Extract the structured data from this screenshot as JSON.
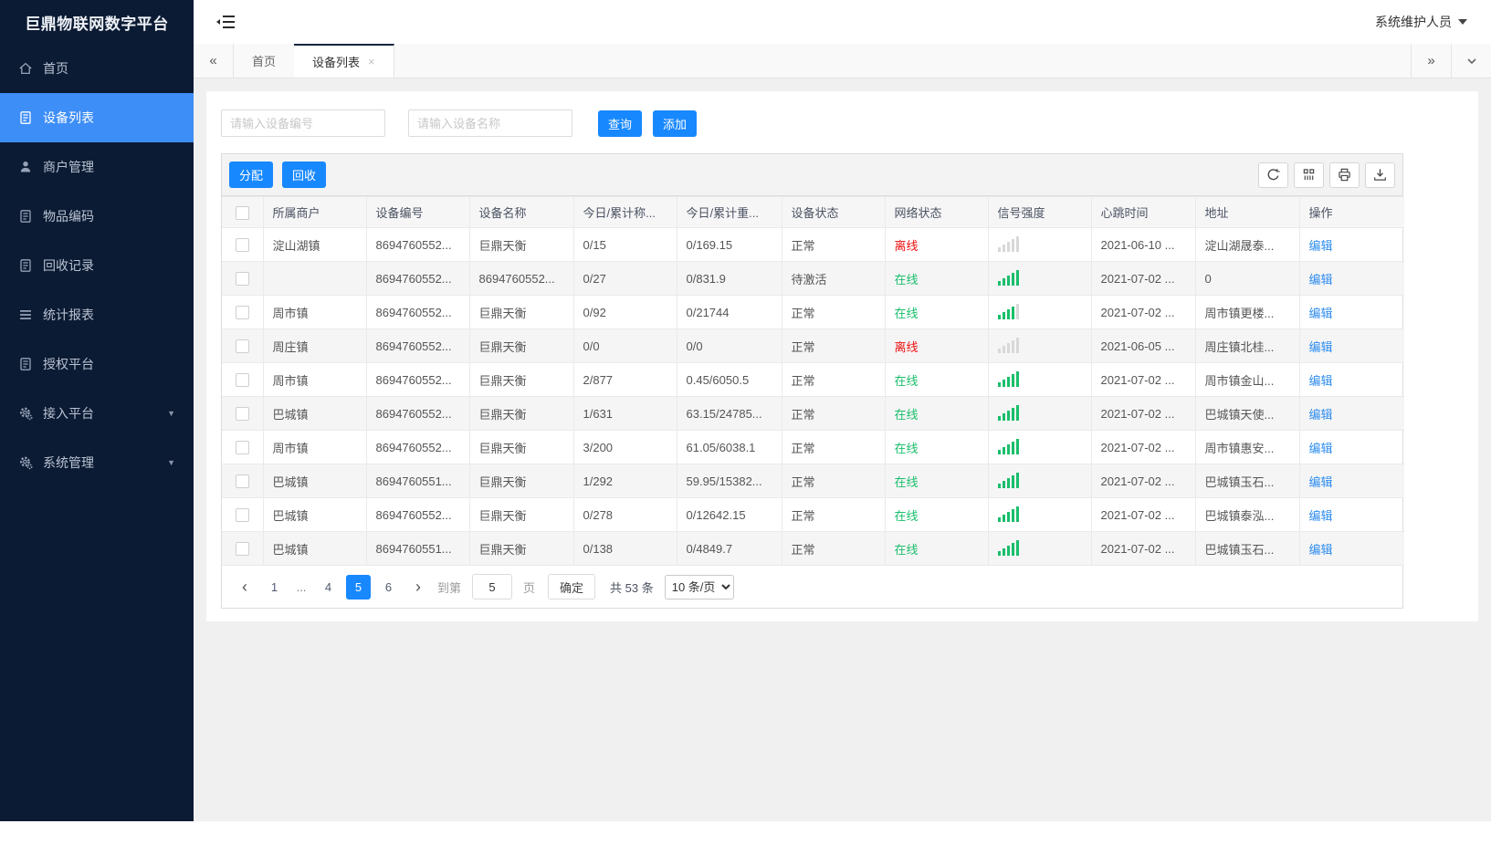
{
  "app": {
    "title": "巨鼎物联网数字平台",
    "user": "系统维护人员"
  },
  "sidebar": {
    "items": [
      {
        "name": "home",
        "label": "首页",
        "icon": "home",
        "active": false,
        "expandable": false
      },
      {
        "name": "device-list",
        "label": "设备列表",
        "icon": "doc",
        "active": true,
        "expandable": false
      },
      {
        "name": "merchant-management",
        "label": "商户管理",
        "icon": "user",
        "active": false,
        "expandable": false
      },
      {
        "name": "item-coding",
        "label": "物品编码",
        "icon": "doc",
        "active": false,
        "expandable": false
      },
      {
        "name": "recycle-records",
        "label": "回收记录",
        "icon": "doc",
        "active": false,
        "expandable": false
      },
      {
        "name": "statistics-report",
        "label": "统计报表",
        "icon": "lines",
        "active": false,
        "expandable": false
      },
      {
        "name": "authorization-platform",
        "label": "授权平台",
        "icon": "doc",
        "active": false,
        "expandable": false
      },
      {
        "name": "access-platform",
        "label": "接入平台",
        "icon": "gear",
        "active": false,
        "expandable": true
      },
      {
        "name": "system-management",
        "label": "系统管理",
        "icon": "gear",
        "active": false,
        "expandable": true
      }
    ]
  },
  "tabs": [
    {
      "name": "home",
      "label": "首页",
      "active": false,
      "closable": false
    },
    {
      "name": "device-list",
      "label": "设备列表",
      "active": true,
      "closable": true
    }
  ],
  "search": {
    "device_no_placeholder": "请输入设备编号",
    "device_name_placeholder": "请输入设备名称",
    "query_label": "查询",
    "add_label": "添加"
  },
  "toolbar": {
    "assign_label": "分配",
    "recycle_label": "回收"
  },
  "table": {
    "columns": [
      "所属商户",
      "设备编号",
      "设备名称",
      "今日/累计称...",
      "今日/累计重...",
      "设备状态",
      "网络状态",
      "信号强度",
      "心跳时间",
      "地址",
      "操作"
    ],
    "rows": [
      {
        "merchant": "淀山湖镇",
        "device_no": "8694760552...",
        "device_name": "巨鼎天衡",
        "today_count": "0/15",
        "today_weight": "0/169.15",
        "status": "正常",
        "network": "离线",
        "online": false,
        "signal": 0,
        "heartbeat": "2021-06-10 ...",
        "address": "淀山湖晟泰...",
        "action": "编辑"
      },
      {
        "merchant": "",
        "device_no": "8694760552...",
        "device_name": "8694760552...",
        "today_count": "0/27",
        "today_weight": "0/831.9",
        "status": "待激活",
        "network": "在线",
        "online": true,
        "signal": 5,
        "heartbeat": "2021-07-02 ...",
        "address": "0",
        "action": "编辑"
      },
      {
        "merchant": "周市镇",
        "device_no": "8694760552...",
        "device_name": "巨鼎天衡",
        "today_count": "0/92",
        "today_weight": "0/21744",
        "status": "正常",
        "network": "在线",
        "online": true,
        "signal": 4,
        "heartbeat": "2021-07-02 ...",
        "address": "周市镇更楼...",
        "action": "编辑"
      },
      {
        "merchant": "周庄镇",
        "device_no": "8694760552...",
        "device_name": "巨鼎天衡",
        "today_count": "0/0",
        "today_weight": "0/0",
        "status": "正常",
        "network": "离线",
        "online": false,
        "signal": 0,
        "heartbeat": "2021-06-05 ...",
        "address": "周庄镇北桂...",
        "action": "编辑"
      },
      {
        "merchant": "周市镇",
        "device_no": "8694760552...",
        "device_name": "巨鼎天衡",
        "today_count": "2/877",
        "today_weight": "0.45/6050.5",
        "status": "正常",
        "network": "在线",
        "online": true,
        "signal": 5,
        "heartbeat": "2021-07-02 ...",
        "address": "周市镇金山...",
        "action": "编辑"
      },
      {
        "merchant": "巴城镇",
        "device_no": "8694760552...",
        "device_name": "巨鼎天衡",
        "today_count": "1/631",
        "today_weight": "63.15/24785...",
        "status": "正常",
        "network": "在线",
        "online": true,
        "signal": 5,
        "heartbeat": "2021-07-02 ...",
        "address": "巴城镇天使...",
        "action": "编辑"
      },
      {
        "merchant": "周市镇",
        "device_no": "8694760552...",
        "device_name": "巨鼎天衡",
        "today_count": "3/200",
        "today_weight": "61.05/6038.1",
        "status": "正常",
        "network": "在线",
        "online": true,
        "signal": 5,
        "heartbeat": "2021-07-02 ...",
        "address": "周市镇惠安...",
        "action": "编辑"
      },
      {
        "merchant": "巴城镇",
        "device_no": "8694760551...",
        "device_name": "巨鼎天衡",
        "today_count": "1/292",
        "today_weight": "59.95/15382...",
        "status": "正常",
        "network": "在线",
        "online": true,
        "signal": 5,
        "heartbeat": "2021-07-02 ...",
        "address": "巴城镇玉石...",
        "action": "编辑"
      },
      {
        "merchant": "巴城镇",
        "device_no": "8694760552...",
        "device_name": "巨鼎天衡",
        "today_count": "0/278",
        "today_weight": "0/12642.15",
        "status": "正常",
        "network": "在线",
        "online": true,
        "signal": 5,
        "heartbeat": "2021-07-02 ...",
        "address": "巴城镇泰泓...",
        "action": "编辑"
      },
      {
        "merchant": "巴城镇",
        "device_no": "8694760551...",
        "device_name": "巨鼎天衡",
        "today_count": "0/138",
        "today_weight": "0/4849.7",
        "status": "正常",
        "network": "在线",
        "online": true,
        "signal": 5,
        "heartbeat": "2021-07-02 ...",
        "address": "巴城镇玉石...",
        "action": "编辑"
      }
    ]
  },
  "pagination": {
    "pages": [
      "1",
      "...",
      "4",
      "5",
      "6"
    ],
    "active_page": "5",
    "goto_label": "到第",
    "goto_value": "5",
    "page_unit": "页",
    "confirm_label": "确定",
    "total_text": "共 53 条",
    "page_size": "10 条/页"
  },
  "icons": {
    "collapse-menu-icon": "menu-fold lines",
    "caret-down-icon": "▼",
    "chevrons-left-icon": "«",
    "chevrons-right-icon": "»",
    "chevron-down-icon": "⌄",
    "chevron-left-icon": "‹",
    "chevron-right-icon": "›",
    "close-icon": "×",
    "refresh-icon": "⟳",
    "columns-icon": "▦",
    "print-icon": "🖨",
    "download-icon": "⤓"
  },
  "colors": {
    "sidebar_bg": "#0b1b33",
    "active_item": "#3e8ef7",
    "primary": "#1888ff",
    "link": "#2d8cf0",
    "online": "#19be6b",
    "offline": "#ee0f0f"
  }
}
